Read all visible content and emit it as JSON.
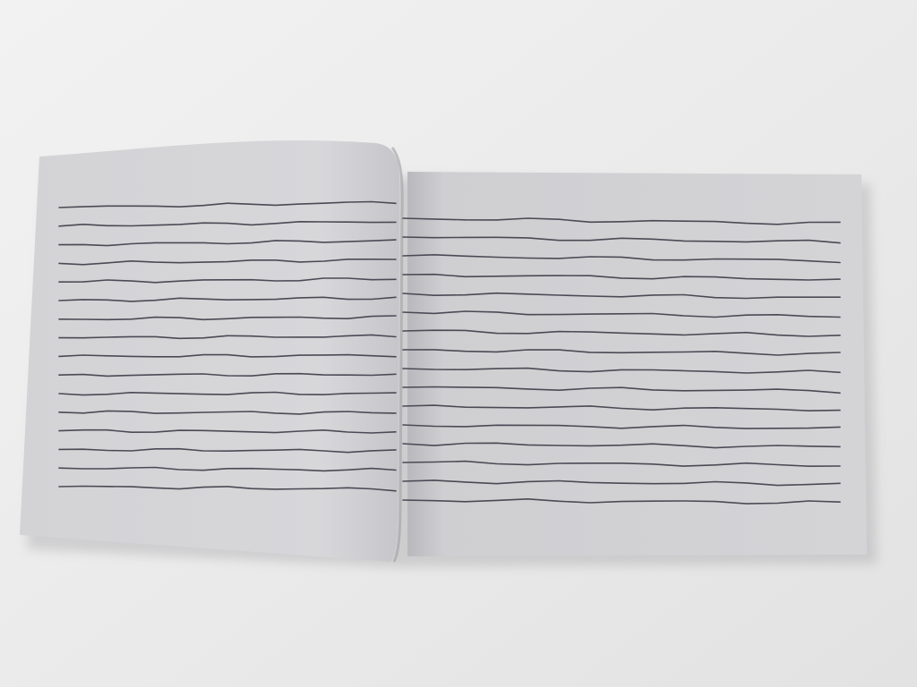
{
  "photo": {
    "subject": "open-booklet-with-hand-drawn-horizontal-lines",
    "colors": {
      "table": "#ebebeb",
      "page": "#cfcfd2",
      "page_light": "#d9d9dc",
      "line": "#4a4a55"
    },
    "left_page": {
      "line_count": 16
    },
    "right_page": {
      "line_count": 16
    }
  }
}
